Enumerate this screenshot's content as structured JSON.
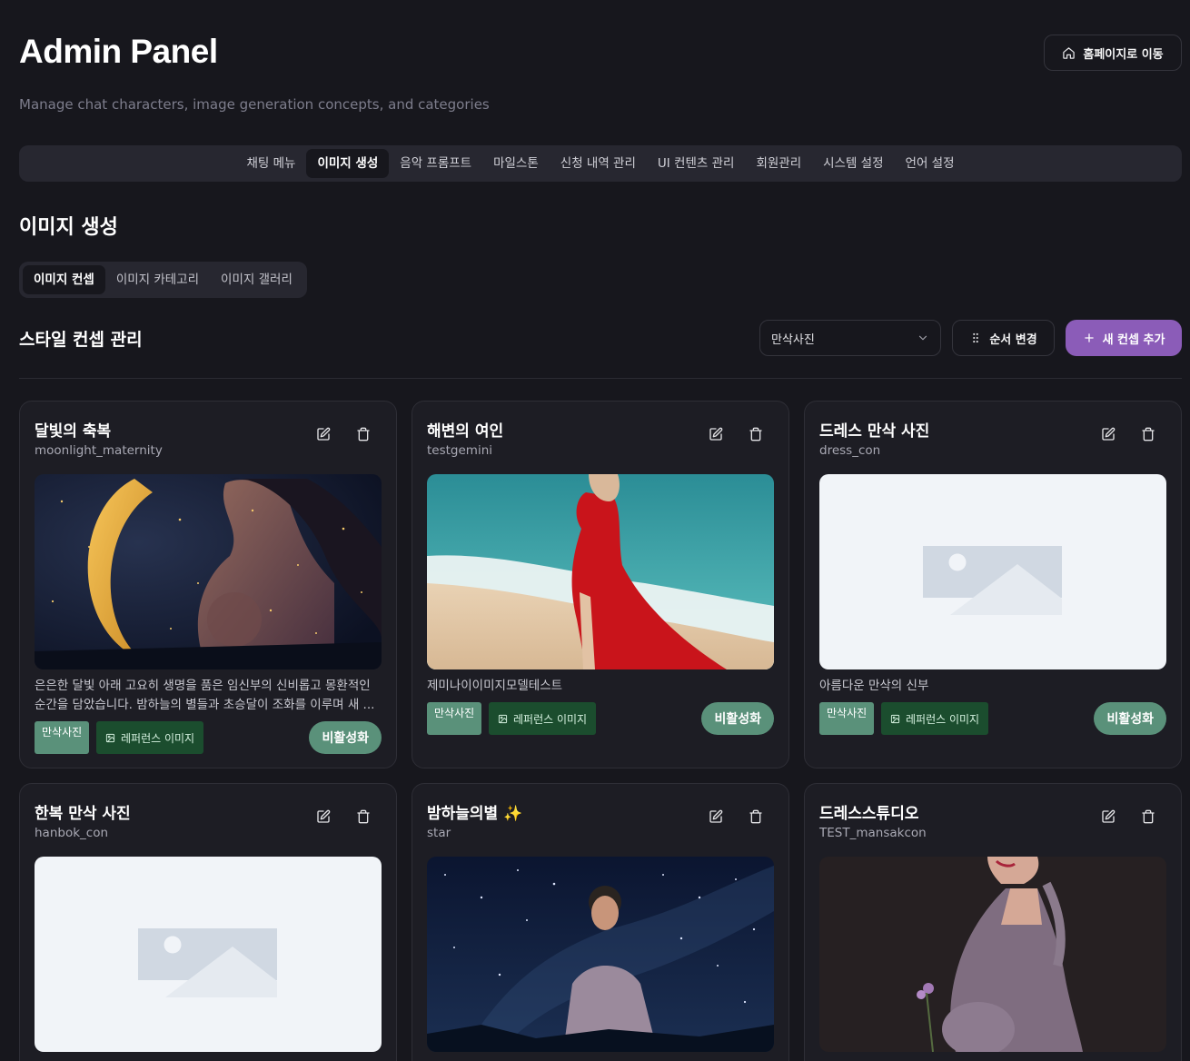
{
  "header": {
    "title": "Admin Panel",
    "subtitle": "Manage chat characters, image generation concepts, and categories",
    "home_button": "홈페이지로 이동"
  },
  "main_nav": {
    "items": [
      "채팅 메뉴",
      "이미지 생성",
      "음악 프롬프트",
      "마일스톤",
      "신청 내역 관리",
      "UI 컨텐츠 관리",
      "회원관리",
      "시스템 설정",
      "언어 설정"
    ],
    "active": "이미지 생성"
  },
  "section_title": "이미지 생성",
  "sub_tabs": {
    "items": [
      "이미지 컨셉",
      "이미지 카테고리",
      "이미지 갤러리"
    ],
    "active": "이미지 컨셉"
  },
  "concepts": {
    "title": "스타일 컨셉 관리",
    "category_select": "만삭사진",
    "reorder_button": "순서 변경",
    "add_button": "새 컨셉 추가"
  },
  "cards": [
    {
      "name": "달빛의 축복",
      "key": "moonlight_maternity",
      "image": "moonlight-pregnant-woman",
      "description": "은은한 달빛 아래 고요히 생명을 품은 임신부의 신비롭고 몽환적인 순간을 담았습니다. 밤하늘의 별들과 초승달이 조화를 이루며 새 ...",
      "category": "만삭사진",
      "reference": "레퍼런스 이미지",
      "status_button": "비활성화"
    },
    {
      "name": "해변의 여인",
      "key": "testgemini",
      "image": "beach-red-dress",
      "description": "제미나이이미지모델테스트",
      "category": "만삭사진",
      "reference": "레퍼런스 이미지",
      "status_button": "비활성화"
    },
    {
      "name": "드레스 만삭 사진",
      "key": "dress_con",
      "image": "placeholder",
      "description": "아름다운 만삭의 신부",
      "category": "만삭사진",
      "reference": "레퍼런스 이미지",
      "status_button": "비활성화"
    },
    {
      "name": "한복 만삭 사진",
      "key": "hanbok_con",
      "image": "placeholder"
    },
    {
      "name": "밤하늘의별 ✨",
      "key": "star",
      "image": "starry-night-woman"
    },
    {
      "name": "드레스스튜디오",
      "key": "TEST_mansakcon",
      "image": "studio-lavender-dress"
    }
  ],
  "colors": {
    "background": "#17171d",
    "card": "#1d1d24",
    "accent_purple": "#8b5cb8",
    "category_chip": "#5a917a",
    "reference_chip": "#1b4d2e"
  }
}
